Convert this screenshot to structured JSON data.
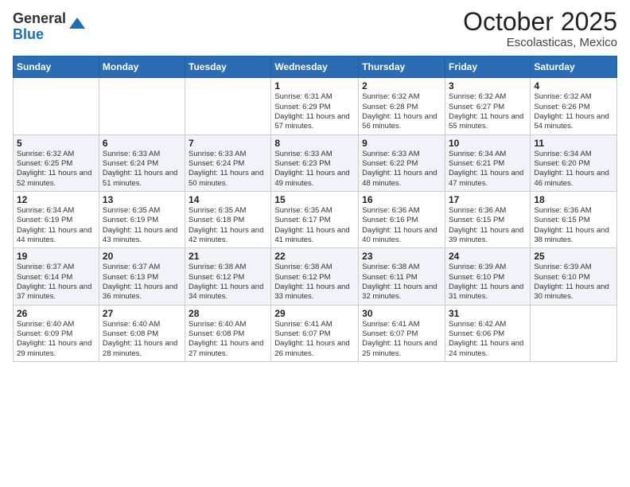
{
  "logo": {
    "general": "General",
    "blue": "Blue"
  },
  "title": "October 2025",
  "subtitle": "Escolasticas, Mexico",
  "days_of_week": [
    "Sunday",
    "Monday",
    "Tuesday",
    "Wednesday",
    "Thursday",
    "Friday",
    "Saturday"
  ],
  "weeks": [
    [
      {
        "day": "",
        "info": ""
      },
      {
        "day": "",
        "info": ""
      },
      {
        "day": "",
        "info": ""
      },
      {
        "day": "1",
        "info": "Sunrise: 6:31 AM\nSunset: 6:29 PM\nDaylight: 11 hours and 57 minutes."
      },
      {
        "day": "2",
        "info": "Sunrise: 6:32 AM\nSunset: 6:28 PM\nDaylight: 11 hours and 56 minutes."
      },
      {
        "day": "3",
        "info": "Sunrise: 6:32 AM\nSunset: 6:27 PM\nDaylight: 11 hours and 55 minutes."
      },
      {
        "day": "4",
        "info": "Sunrise: 6:32 AM\nSunset: 6:26 PM\nDaylight: 11 hours and 54 minutes."
      }
    ],
    [
      {
        "day": "5",
        "info": "Sunrise: 6:32 AM\nSunset: 6:25 PM\nDaylight: 11 hours and 52 minutes."
      },
      {
        "day": "6",
        "info": "Sunrise: 6:33 AM\nSunset: 6:24 PM\nDaylight: 11 hours and 51 minutes."
      },
      {
        "day": "7",
        "info": "Sunrise: 6:33 AM\nSunset: 6:24 PM\nDaylight: 11 hours and 50 minutes."
      },
      {
        "day": "8",
        "info": "Sunrise: 6:33 AM\nSunset: 6:23 PM\nDaylight: 11 hours and 49 minutes."
      },
      {
        "day": "9",
        "info": "Sunrise: 6:33 AM\nSunset: 6:22 PM\nDaylight: 11 hours and 48 minutes."
      },
      {
        "day": "10",
        "info": "Sunrise: 6:34 AM\nSunset: 6:21 PM\nDaylight: 11 hours and 47 minutes."
      },
      {
        "day": "11",
        "info": "Sunrise: 6:34 AM\nSunset: 6:20 PM\nDaylight: 11 hours and 46 minutes."
      }
    ],
    [
      {
        "day": "12",
        "info": "Sunrise: 6:34 AM\nSunset: 6:19 PM\nDaylight: 11 hours and 44 minutes."
      },
      {
        "day": "13",
        "info": "Sunrise: 6:35 AM\nSunset: 6:19 PM\nDaylight: 11 hours and 43 minutes."
      },
      {
        "day": "14",
        "info": "Sunrise: 6:35 AM\nSunset: 6:18 PM\nDaylight: 11 hours and 42 minutes."
      },
      {
        "day": "15",
        "info": "Sunrise: 6:35 AM\nSunset: 6:17 PM\nDaylight: 11 hours and 41 minutes."
      },
      {
        "day": "16",
        "info": "Sunrise: 6:36 AM\nSunset: 6:16 PM\nDaylight: 11 hours and 40 minutes."
      },
      {
        "day": "17",
        "info": "Sunrise: 6:36 AM\nSunset: 6:15 PM\nDaylight: 11 hours and 39 minutes."
      },
      {
        "day": "18",
        "info": "Sunrise: 6:36 AM\nSunset: 6:15 PM\nDaylight: 11 hours and 38 minutes."
      }
    ],
    [
      {
        "day": "19",
        "info": "Sunrise: 6:37 AM\nSunset: 6:14 PM\nDaylight: 11 hours and 37 minutes."
      },
      {
        "day": "20",
        "info": "Sunrise: 6:37 AM\nSunset: 6:13 PM\nDaylight: 11 hours and 36 minutes."
      },
      {
        "day": "21",
        "info": "Sunrise: 6:38 AM\nSunset: 6:12 PM\nDaylight: 11 hours and 34 minutes."
      },
      {
        "day": "22",
        "info": "Sunrise: 6:38 AM\nSunset: 6:12 PM\nDaylight: 11 hours and 33 minutes."
      },
      {
        "day": "23",
        "info": "Sunrise: 6:38 AM\nSunset: 6:11 PM\nDaylight: 11 hours and 32 minutes."
      },
      {
        "day": "24",
        "info": "Sunrise: 6:39 AM\nSunset: 6:10 PM\nDaylight: 11 hours and 31 minutes."
      },
      {
        "day": "25",
        "info": "Sunrise: 6:39 AM\nSunset: 6:10 PM\nDaylight: 11 hours and 30 minutes."
      }
    ],
    [
      {
        "day": "26",
        "info": "Sunrise: 6:40 AM\nSunset: 6:09 PM\nDaylight: 11 hours and 29 minutes."
      },
      {
        "day": "27",
        "info": "Sunrise: 6:40 AM\nSunset: 6:08 PM\nDaylight: 11 hours and 28 minutes."
      },
      {
        "day": "28",
        "info": "Sunrise: 6:40 AM\nSunset: 6:08 PM\nDaylight: 11 hours and 27 minutes."
      },
      {
        "day": "29",
        "info": "Sunrise: 6:41 AM\nSunset: 6:07 PM\nDaylight: 11 hours and 26 minutes."
      },
      {
        "day": "30",
        "info": "Sunrise: 6:41 AM\nSunset: 6:07 PM\nDaylight: 11 hours and 25 minutes."
      },
      {
        "day": "31",
        "info": "Sunrise: 6:42 AM\nSunset: 6:06 PM\nDaylight: 11 hours and 24 minutes."
      },
      {
        "day": "",
        "info": ""
      }
    ]
  ]
}
